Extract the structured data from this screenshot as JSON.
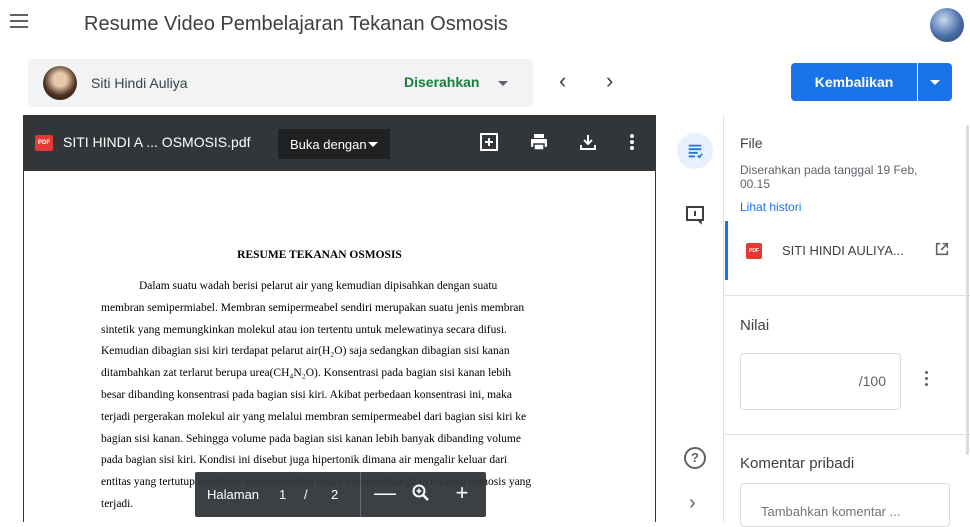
{
  "header": {
    "title": "Resume Video Pembelajaran Tekanan Osmosis"
  },
  "student": {
    "name": "Siti Hindi Auliya",
    "status": "Diserahkan"
  },
  "actions": {
    "return_label": "Kembalikan"
  },
  "viewer": {
    "filename": "SITI HINDI A ... OSMOSIS.pdf",
    "open_with_label": "Buka dengan",
    "pdf_badge": "PDF",
    "document": {
      "heading": "RESUME TEKANAN OSMOSIS",
      "lines": [
        "Dalam suatu wadah berisi pelarut air yang kemudian dipisahkan dengan suatu",
        "membran semipermiabel. Membran semipermeabel sendiri merupakan suatu jenis membran",
        "sintetik yang memungkinkan molekul atau ion tertentu untuk melewatinya secara difusi.",
        "Kemudian dibagian sisi kiri terdapat pelarut air(H₂O) saja sedangkan dibagian sisi kanan",
        "ditambahkan zat terlarut berupa urea(CH₄N₂O). Konsentrasi pada bagian sisi kanan lebih",
        "besar dibanding konsentrasi pada bagian sisi kiri. Akibat perbedaan konsentrasi ini, maka",
        "terjadi pergerakan molekul air yang melalui membran semipermeabel dari bagian sisi kiri ke",
        "bagian sisi kanan. Sehingga volume pada bagian sisi kanan lebih banyak dibanding volume",
        "pada bagian sisi kiri. Kondisi ini disebut juga hipertonik dimana air mengalir keluar dari",
        "entitas yang tertutup membran semipermeabel untuk menyeimbangkan tekanan osmosis yang",
        "terjadi."
      ]
    },
    "page_control": {
      "label": "Halaman",
      "current": "1",
      "separator": "/",
      "total": "2"
    }
  },
  "panel": {
    "file_title": "File",
    "submitted_text": "Diserahkan pada tanggal 19 Feb, 00.15",
    "history_link": "Lihat histori",
    "attachment": {
      "badge": "PDF",
      "name": "SITI HINDI AULIYA..."
    },
    "grade_title": "Nilai",
    "grade_max": "/100",
    "comment_title": "Komentar pribadi",
    "comment_placeholder": "Tambahkan komentar ..."
  },
  "colors": {
    "accent": "#1a73e8",
    "status": "#188038",
    "viewer_bg": "#323639",
    "pdf_red": "#e53935"
  },
  "icons": {
    "menu": "hamburger-icon",
    "prev": "chevron-left-icon",
    "next": "chevron-right-icon",
    "add_comment": "add-box-icon",
    "print": "print-icon",
    "download": "download-icon",
    "more": "more-vert-icon",
    "file_panel": "assignment-icon",
    "comments_panel": "comment-icon",
    "help": "help-icon",
    "expand": "chevron-right-icon",
    "open_new": "open-in-new-icon",
    "zoom_out": "minus-icon",
    "zoom": "magnifier-icon",
    "zoom_in": "plus-icon"
  }
}
